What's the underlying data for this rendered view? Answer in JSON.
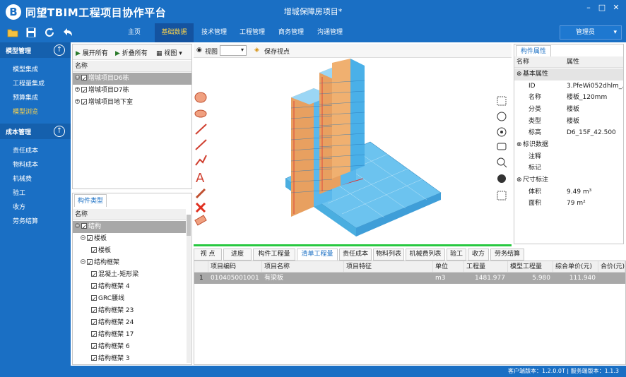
{
  "app": {
    "logo_letter": "B",
    "title": "同望TBIM工程项目协作平台",
    "project": "增城保障房项目*",
    "win_min": "–",
    "win_max": "□",
    "win_close": "✕"
  },
  "menu": {
    "items": [
      "主页",
      "基础数据",
      "技术管理",
      "工程管理",
      "商务管理",
      "沟通管理"
    ],
    "active": "基础数据",
    "user": "管理员"
  },
  "sidebar": {
    "section1": "模型管理",
    "section1_items": [
      "模型集成",
      "工程量集成",
      "预算集成",
      "模型浏览"
    ],
    "section1_active": "模型浏览",
    "section2": "成本管理",
    "section2_items": [
      "责任成本",
      "物料成本",
      "机械费",
      "验工",
      "收方",
      "劳务结算"
    ]
  },
  "tree": {
    "expand_all": "展开所有",
    "collapse_all": "折叠所有",
    "view": "视图",
    "header": "名称",
    "items": [
      "增城项目D6栋",
      "增城项目D7栋",
      "增城项目地下室"
    ]
  },
  "types": {
    "tab": "构件类型",
    "header": "名称",
    "items": [
      "结构",
      "楼板",
      "楼板",
      "结构框架",
      "混凝土-矩形梁",
      "结构框架 4",
      "GRC腰线",
      "结构框架 23",
      "结构框架 24",
      "结构框架 17",
      "结构框架 6",
      "结构框架 3"
    ]
  },
  "viewbar": {
    "view": "视图",
    "save": "保存视点"
  },
  "props": {
    "tab": "构件属性",
    "col_name": "名称",
    "col_value": "属性",
    "cat_basic": "基本属性",
    "id_label": "ID",
    "id_value": "3.PfeWi052dhlm_...",
    "name_label": "名称",
    "name_value": "楼板_120mm",
    "class_label": "分类",
    "class_value": "楼板",
    "type_label": "类型",
    "type_value": "楼板",
    "elev_label": "标高",
    "elev_value": "D6_15F_42.500",
    "cat_ident": "标识数据",
    "note_label": "注释",
    "mark_label": "标记",
    "cat_size": "尺寸标注",
    "vol_label": "体积",
    "vol_value": "9.49 m³",
    "area_label": "面积",
    "area_value": "79 m²"
  },
  "bottom_tabs": [
    "视 点",
    "进度",
    "构件工程量",
    "清单工程量",
    "责任成本",
    "物料列表",
    "机械费列表",
    "验工",
    "收方",
    "劳务结算"
  ],
  "bottom_active": "清单工程量",
  "grid": {
    "headers": [
      "",
      "项目编码",
      "项目名称",
      "项目特征",
      "单位",
      "工程量",
      "模型工程量",
      "综合单价(元)",
      "合价(元)"
    ],
    "row": [
      "1",
      "010405001001",
      "有梁板",
      "",
      "m3",
      "1481.977",
      "5.980",
      "111.940",
      ""
    ]
  },
  "status": "客户端版本：1.2.0.0T  |  服务端版本：1.1.3"
}
